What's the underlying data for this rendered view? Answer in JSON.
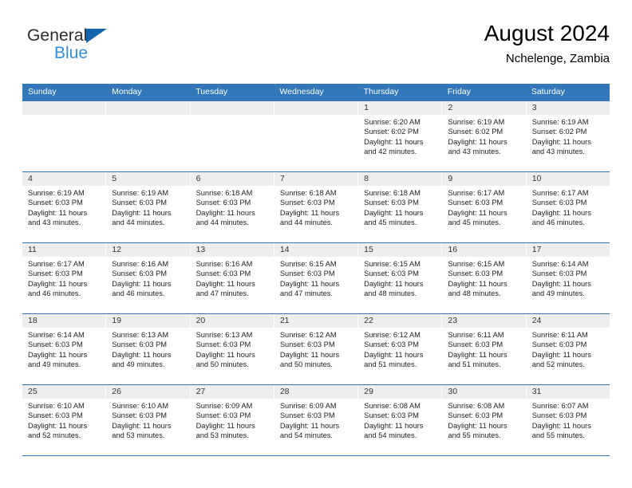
{
  "brand": {
    "name_top": "General",
    "name_bottom": "Blue",
    "accent_dark": "#1264ad",
    "accent_light": "#2e8fe0"
  },
  "header": {
    "title": "August 2024",
    "subtitle": "Nchelenge, Zambia"
  },
  "theme": {
    "header_blue": "#3377bb",
    "day_band_gray": "#eeeeee"
  },
  "weekdays": [
    "Sunday",
    "Monday",
    "Tuesday",
    "Wednesday",
    "Thursday",
    "Friday",
    "Saturday"
  ],
  "weeks": [
    [
      {
        "day": "",
        "lines": []
      },
      {
        "day": "",
        "lines": []
      },
      {
        "day": "",
        "lines": []
      },
      {
        "day": "",
        "lines": []
      },
      {
        "day": "1",
        "lines": [
          "Sunrise: 6:20 AM",
          "Sunset: 6:02 PM",
          "Daylight: 11 hours",
          "and 42 minutes."
        ]
      },
      {
        "day": "2",
        "lines": [
          "Sunrise: 6:19 AM",
          "Sunset: 6:02 PM",
          "Daylight: 11 hours",
          "and 43 minutes."
        ]
      },
      {
        "day": "3",
        "lines": [
          "Sunrise: 6:19 AM",
          "Sunset: 6:02 PM",
          "Daylight: 11 hours",
          "and 43 minutes."
        ]
      }
    ],
    [
      {
        "day": "4",
        "lines": [
          "Sunrise: 6:19 AM",
          "Sunset: 6:03 PM",
          "Daylight: 11 hours",
          "and 43 minutes."
        ]
      },
      {
        "day": "5",
        "lines": [
          "Sunrise: 6:19 AM",
          "Sunset: 6:03 PM",
          "Daylight: 11 hours",
          "and 44 minutes."
        ]
      },
      {
        "day": "6",
        "lines": [
          "Sunrise: 6:18 AM",
          "Sunset: 6:03 PM",
          "Daylight: 11 hours",
          "and 44 minutes."
        ]
      },
      {
        "day": "7",
        "lines": [
          "Sunrise: 6:18 AM",
          "Sunset: 6:03 PM",
          "Daylight: 11 hours",
          "and 44 minutes."
        ]
      },
      {
        "day": "8",
        "lines": [
          "Sunrise: 6:18 AM",
          "Sunset: 6:03 PM",
          "Daylight: 11 hours",
          "and 45 minutes."
        ]
      },
      {
        "day": "9",
        "lines": [
          "Sunrise: 6:17 AM",
          "Sunset: 6:03 PM",
          "Daylight: 11 hours",
          "and 45 minutes."
        ]
      },
      {
        "day": "10",
        "lines": [
          "Sunrise: 6:17 AM",
          "Sunset: 6:03 PM",
          "Daylight: 11 hours",
          "and 46 minutes."
        ]
      }
    ],
    [
      {
        "day": "11",
        "lines": [
          "Sunrise: 6:17 AM",
          "Sunset: 6:03 PM",
          "Daylight: 11 hours",
          "and 46 minutes."
        ]
      },
      {
        "day": "12",
        "lines": [
          "Sunrise: 6:16 AM",
          "Sunset: 6:03 PM",
          "Daylight: 11 hours",
          "and 46 minutes."
        ]
      },
      {
        "day": "13",
        "lines": [
          "Sunrise: 6:16 AM",
          "Sunset: 6:03 PM",
          "Daylight: 11 hours",
          "and 47 minutes."
        ]
      },
      {
        "day": "14",
        "lines": [
          "Sunrise: 6:15 AM",
          "Sunset: 6:03 PM",
          "Daylight: 11 hours",
          "and 47 minutes."
        ]
      },
      {
        "day": "15",
        "lines": [
          "Sunrise: 6:15 AM",
          "Sunset: 6:03 PM",
          "Daylight: 11 hours",
          "and 48 minutes."
        ]
      },
      {
        "day": "16",
        "lines": [
          "Sunrise: 6:15 AM",
          "Sunset: 6:03 PM",
          "Daylight: 11 hours",
          "and 48 minutes."
        ]
      },
      {
        "day": "17",
        "lines": [
          "Sunrise: 6:14 AM",
          "Sunset: 6:03 PM",
          "Daylight: 11 hours",
          "and 49 minutes."
        ]
      }
    ],
    [
      {
        "day": "18",
        "lines": [
          "Sunrise: 6:14 AM",
          "Sunset: 6:03 PM",
          "Daylight: 11 hours",
          "and 49 minutes."
        ]
      },
      {
        "day": "19",
        "lines": [
          "Sunrise: 6:13 AM",
          "Sunset: 6:03 PM",
          "Daylight: 11 hours",
          "and 49 minutes."
        ]
      },
      {
        "day": "20",
        "lines": [
          "Sunrise: 6:13 AM",
          "Sunset: 6:03 PM",
          "Daylight: 11 hours",
          "and 50 minutes."
        ]
      },
      {
        "day": "21",
        "lines": [
          "Sunrise: 6:12 AM",
          "Sunset: 6:03 PM",
          "Daylight: 11 hours",
          "and 50 minutes."
        ]
      },
      {
        "day": "22",
        "lines": [
          "Sunrise: 6:12 AM",
          "Sunset: 6:03 PM",
          "Daylight: 11 hours",
          "and 51 minutes."
        ]
      },
      {
        "day": "23",
        "lines": [
          "Sunrise: 6:11 AM",
          "Sunset: 6:03 PM",
          "Daylight: 11 hours",
          "and 51 minutes."
        ]
      },
      {
        "day": "24",
        "lines": [
          "Sunrise: 6:11 AM",
          "Sunset: 6:03 PM",
          "Daylight: 11 hours",
          "and 52 minutes."
        ]
      }
    ],
    [
      {
        "day": "25",
        "lines": [
          "Sunrise: 6:10 AM",
          "Sunset: 6:03 PM",
          "Daylight: 11 hours",
          "and 52 minutes."
        ]
      },
      {
        "day": "26",
        "lines": [
          "Sunrise: 6:10 AM",
          "Sunset: 6:03 PM",
          "Daylight: 11 hours",
          "and 53 minutes."
        ]
      },
      {
        "day": "27",
        "lines": [
          "Sunrise: 6:09 AM",
          "Sunset: 6:03 PM",
          "Daylight: 11 hours",
          "and 53 minutes."
        ]
      },
      {
        "day": "28",
        "lines": [
          "Sunrise: 6:09 AM",
          "Sunset: 6:03 PM",
          "Daylight: 11 hours",
          "and 54 minutes."
        ]
      },
      {
        "day": "29",
        "lines": [
          "Sunrise: 6:08 AM",
          "Sunset: 6:03 PM",
          "Daylight: 11 hours",
          "and 54 minutes."
        ]
      },
      {
        "day": "30",
        "lines": [
          "Sunrise: 6:08 AM",
          "Sunset: 6:03 PM",
          "Daylight: 11 hours",
          "and 55 minutes."
        ]
      },
      {
        "day": "31",
        "lines": [
          "Sunrise: 6:07 AM",
          "Sunset: 6:03 PM",
          "Daylight: 11 hours",
          "and 55 minutes."
        ]
      }
    ]
  ]
}
